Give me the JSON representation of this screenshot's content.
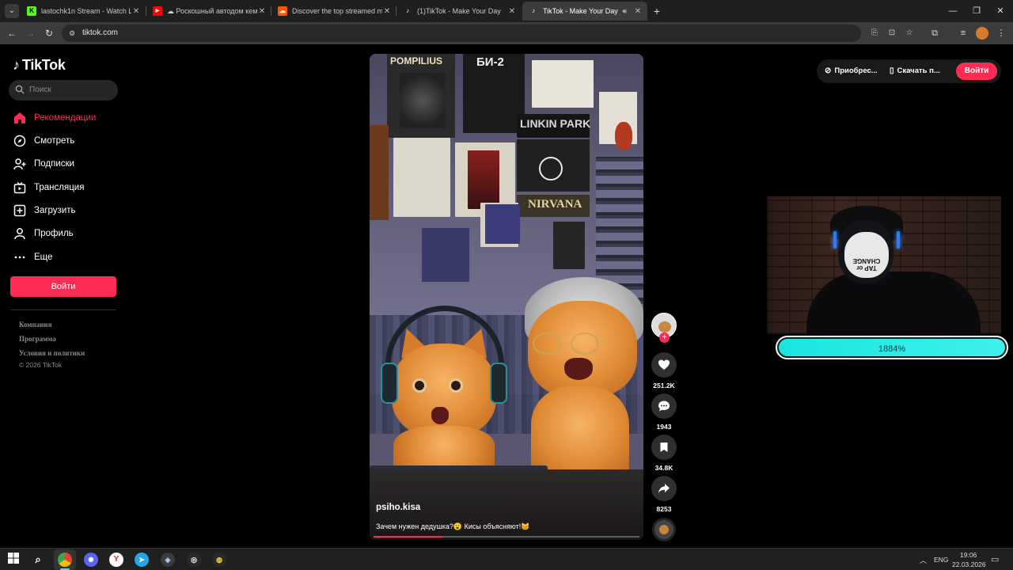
{
  "browser": {
    "tabs": [
      {
        "title": "lastochk1n Stream - Watch Live",
        "favicon": "kick-icon",
        "color": "#53fc18"
      },
      {
        "title": "☁ Роскошный автодом кемп",
        "favicon": "youtube-icon",
        "color": "#ff0000"
      },
      {
        "title": "Discover the top streamed mu",
        "favicon": "soundcloud-icon",
        "color": "#ff5500"
      },
      {
        "title": "(1)TikTok - Make Your Day",
        "favicon": "tiktok-icon",
        "color": "#000000"
      },
      {
        "title": "TikTok - Make Your Day",
        "favicon": "tiktok-icon",
        "color": "#000000",
        "active": true
      }
    ],
    "url": "tiktok.com"
  },
  "sidebar": {
    "logo": "TikTok",
    "search_placeholder": "Поиск",
    "nav": [
      {
        "label": "Рекомендации",
        "icon": "home-icon",
        "active": true
      },
      {
        "label": "Смотреть",
        "icon": "compass-icon"
      },
      {
        "label": "Подписки",
        "icon": "following-icon"
      },
      {
        "label": "Трансляция",
        "icon": "live-icon"
      },
      {
        "label": "Загрузить",
        "icon": "upload-icon"
      },
      {
        "label": "Профиль",
        "icon": "profile-icon"
      },
      {
        "label": "Еще",
        "icon": "more-icon"
      }
    ],
    "login_label": "Войти",
    "footer_links": [
      "Компания",
      "Программа",
      "Условия и политики"
    ],
    "copyright": "© 2026 TikTok"
  },
  "header": {
    "buy_label": "Приобрес...",
    "download_label": "Скачать п...",
    "login_label": "Войти"
  },
  "video": {
    "username": "psiho.kisa",
    "description": "Зачем нужен дедушка?😮 Кисы объясняют!😸",
    "progress": 0.26,
    "poster_texts": [
      "POMPILIUS",
      "БИ-2",
      "LINKIN PARK",
      "NIRVANA"
    ],
    "likes": "251.2K",
    "comments": "1943",
    "saves": "34.8K",
    "shares": "8253"
  },
  "stream_overlay": {
    "mask_text": "TAP or CHANGE",
    "goal_text": "1884%"
  },
  "taskbar": {
    "language": "ENG",
    "time": "19:06",
    "date": "22.03.2026"
  },
  "colors": {
    "accent": "#fe2c55",
    "goal": "#19e6e0"
  }
}
